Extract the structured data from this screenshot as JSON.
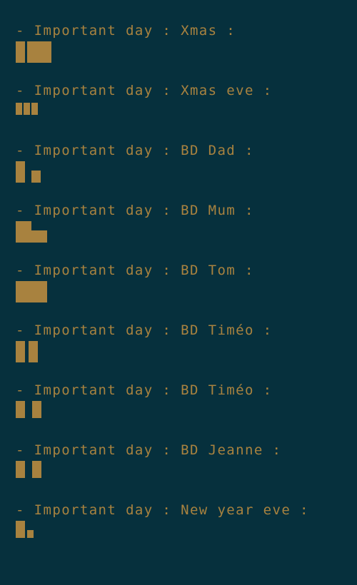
{
  "terminal": {
    "background_color": "#06303d",
    "text_color": "#a8823f",
    "bullet_glyph": "-",
    "label": "Important day",
    "separator": " : ",
    "trailing": " :",
    "entries": [
      {
        "bullet": "-",
        "line": "- Important day : Xmas :",
        "label": "Important day",
        "value": "Xmas",
        "glyph_count": 2,
        "glyph_note": "unrenderable-emoji-boxes"
      },
      {
        "bullet": "-",
        "line": "- Important day : Xmas eve :",
        "label": "Important day",
        "value": "Xmas eve",
        "glyph_count": 3,
        "glyph_note": "unrenderable-emoji-boxes"
      },
      {
        "bullet": "-",
        "line": "- Important day : BD Dad :",
        "label": "Important day",
        "value": "BD Dad",
        "glyph_count": 2,
        "glyph_note": "unrenderable-emoji-boxes"
      },
      {
        "bullet": "-",
        "line": "- Important day : BD Mum :",
        "label": "Important day",
        "value": "BD Mum",
        "glyph_count": 2,
        "glyph_note": "unrenderable-emoji-boxes"
      },
      {
        "bullet": "-",
        "line": "- Important day : BD Tom :",
        "label": "Important day",
        "value": "BD Tom",
        "glyph_count": 2,
        "glyph_note": "unrenderable-emoji-boxes"
      },
      {
        "bullet": "-",
        "line": "- Important day : BD Timéo :",
        "label": "Important day",
        "value": "BD Timéo",
        "glyph_count": 2,
        "glyph_note": "unrenderable-emoji-boxes"
      },
      {
        "bullet": "-",
        "line": "- Important day : BD Timéo :",
        "label": "Important day",
        "value": "BD Timéo",
        "glyph_count": 2,
        "glyph_note": "unrenderable-emoji-boxes"
      },
      {
        "bullet": "-",
        "line": "- Important day : BD Jeanne :",
        "label": "Important day",
        "value": "BD Jeanne",
        "glyph_count": 2,
        "glyph_note": "unrenderable-emoji-boxes"
      },
      {
        "bullet": "-",
        "line": "- Important day : New year eve :",
        "label": "Important day",
        "value": "New year eve",
        "glyph_count": 2,
        "glyph_note": "unrenderable-emoji-boxes"
      }
    ]
  }
}
